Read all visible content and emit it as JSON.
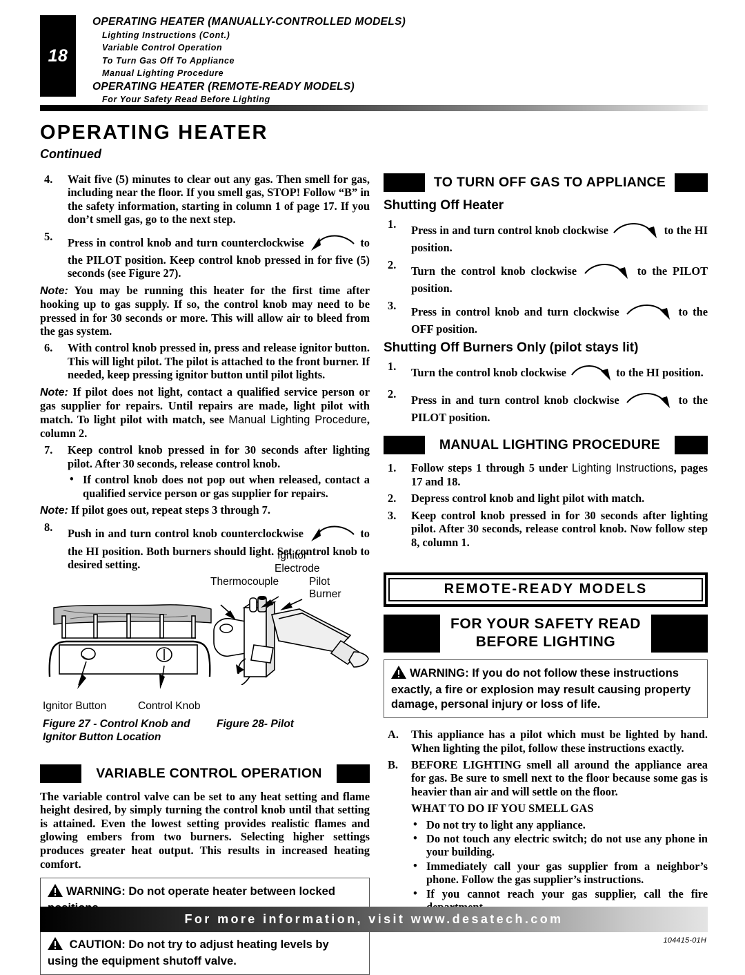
{
  "header": {
    "page_number": "18",
    "toc": [
      {
        "text": "OPERATING HEATER (MANUALLY-CONTROLLED MODELS)",
        "level": 1
      },
      {
        "text": "Lighting Instructions (Cont.)",
        "level": 2
      },
      {
        "text": "Variable Control Operation",
        "level": 2
      },
      {
        "text": "To Turn Gas Off To Appliance",
        "level": 2
      },
      {
        "text": "Manual Lighting Procedure",
        "level": 2
      },
      {
        "text": "OPERATING HEATER (REMOTE-READY MODELS)",
        "level": 1
      },
      {
        "text": "For Your Safety Read Before Lighting",
        "level": 2
      }
    ]
  },
  "title": {
    "main": "OPERATING HEATER",
    "sub": "Continued"
  },
  "left_column": {
    "step4": {
      "num": "4.",
      "text": "Wait five (5) minutes to clear out any gas. Then smell for gas, including near the floor. If you smell gas, STOP! Follow “B” in the safety information, starting in column 1 of page 17. If you don’t smell gas, go to the next step."
    },
    "step5": {
      "num": "5.",
      "text_a": "Press in control knob and turn counterclockwise",
      "text_b": "to the PILOT position. Keep control knob pressed in for five (5) seconds (see Figure 27)."
    },
    "note5": {
      "label": "Note:",
      "text": "You may be running this heater for the first time after hooking up to gas supply. If so, the control knob may need to be pressed in for 30 seconds or more. This will allow air to bleed from the gas system."
    },
    "step6": {
      "num": "6.",
      "text": "With control knob pressed in, press and release ignitor button. This will light pilot. The pilot is attached to the front burner. If needed, keep pressing ignitor button until pilot lights."
    },
    "note6": {
      "label": "Note:",
      "text_a": "If pilot does not light, contact a qualified service person or gas supplier for repairs. Until repairs are made, light pilot with match. To light pilot with match, see ",
      "ref": "Manual Lighting Procedure",
      "text_b": ", column 2."
    },
    "step7": {
      "num": "7.",
      "text": "Keep control knob pressed in for 30 seconds after lighting pilot. After 30 seconds, release control knob.",
      "bullet": "If control knob does not pop out when released, contact a qualified service person or gas supplier for repairs."
    },
    "note7": {
      "label": "Note:",
      "text": "If pilot goes out, repeat steps 3 through 7."
    },
    "step8": {
      "num": "8.",
      "text_a": "Push in and turn control knob counterclockwise",
      "text_b": "to the HI position. Both burners should light. Set control knob to desired setting."
    },
    "figure27": {
      "caption_line1": "Figure 27 - Control Knob and",
      "caption_line2": "Ignitor Button Location",
      "label_ignitor_button": "Ignitor Button",
      "label_control_knob": "Control Knob"
    },
    "figure28": {
      "caption": "Figure 28- Pilot",
      "label_thermocouple": "Thermocouple",
      "label_ignitor": "Ignitor",
      "label_electrode": "Electrode",
      "label_pilot": "Pilot",
      "label_burner": "Burner"
    },
    "variable_control": {
      "heading": "VARIABLE CONTROL OPERATION",
      "paragraph": "The variable control valve can be set to any heat setting and flame height desired, by simply turning the control knob until that setting is attained. Even the lowest setting provides realistic flames and glowing embers from two burners. Selecting higher settings produces greater heat output. This results in increased heating comfort.",
      "warning": "WARNING: Do not operate heater between locked positions.",
      "caution": "CAUTION: Do not try to adjust heating levels by using the equipment shutoff valve."
    }
  },
  "right_column": {
    "turn_off_gas": {
      "heading": "TO TURN OFF GAS TO APPLIANCE",
      "subhead1": "Shutting Off Heater",
      "steps1": [
        {
          "num": "1.",
          "text_a": "Press in and turn control knob clockwise",
          "text_b": "to the HI position."
        },
        {
          "num": "2.",
          "text_a": "Turn the control knob clockwise",
          "text_b": "to the PILOT position."
        },
        {
          "num": "3.",
          "text_a": "Press in control knob and turn clockwise",
          "text_b": "to the OFF position."
        }
      ],
      "subhead2": "Shutting Off Burners Only (pilot stays lit)",
      "steps2": [
        {
          "num": "1.",
          "text_a": "Turn the control knob clockwise",
          "text_b": "to the HI position."
        },
        {
          "num": "2.",
          "text_a": "Press in and turn control knob clockwise",
          "text_b": "to the PILOT position."
        }
      ]
    },
    "manual_lighting": {
      "heading": "MANUAL LIGHTING PROCEDURE",
      "steps": [
        {
          "num": "1.",
          "text_a": "Follow steps 1 through 5 under ",
          "ref": "Lighting Instructions",
          "text_b": ", pages 17 and 18."
        },
        {
          "num": "2.",
          "text_a": "Depress control knob and light pilot with match.",
          "ref": "",
          "text_b": ""
        },
        {
          "num": "3.",
          "text_a": "Keep control knob pressed in for 30 seconds after lighting pilot. After 30 seconds, release control knob. Now follow step 8, column 1.",
          "ref": "",
          "text_b": ""
        }
      ]
    },
    "remote_ready": {
      "band": "REMOTE-READY MODELS",
      "heading_line1": "FOR YOUR SAFETY READ",
      "heading_line2": "BEFORE LIGHTING",
      "warning": "WARNING: If you do not follow these instructions exactly, a fire or explosion may result causing property damage, personal injury or loss of life.",
      "item_a": {
        "num": "A.",
        "text": "This appliance has a pilot which must be lighted by hand. When lighting the pilot, follow these instructions exactly."
      },
      "item_b": {
        "num": "B.",
        "text": "BEFORE LIGHTING smell all around the appliance area for gas. Be sure to smell next to the floor because some gas is heavier than air and will settle on the floor."
      },
      "smell_gas_heading": "WHAT TO DO IF YOU SMELL GAS",
      "smell_gas_bullets": [
        "Do not try to light any appliance.",
        "Do not touch any electric switch; do not use any phone in your building.",
        "Immediately call your gas supplier from a neighbor’s phone. Follow the gas supplier’s instructions.",
        "If you cannot reach your gas supplier, call the fire department."
      ]
    }
  },
  "footer": {
    "text": "For more information, visit www.desatech.com",
    "doc_number": "104415-01H"
  }
}
